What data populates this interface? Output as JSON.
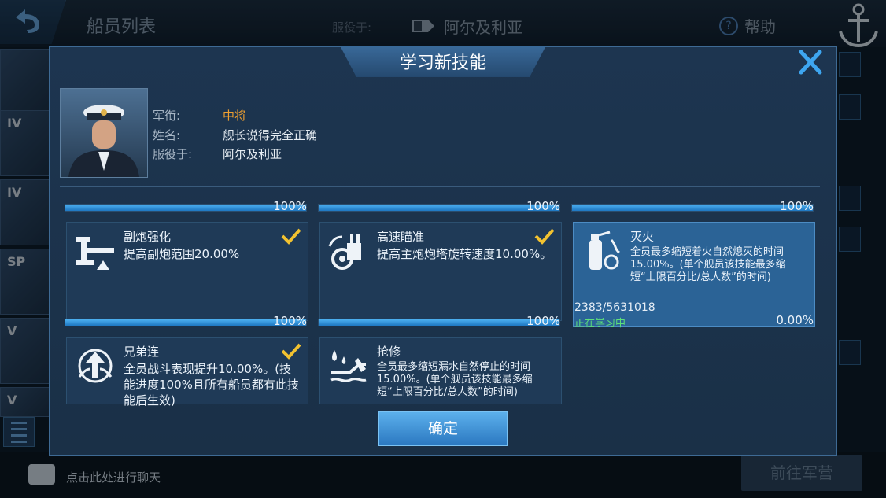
{
  "topbar": {
    "tab_title": "船员列表",
    "serving_label": "服役于:",
    "serving_ship": "阿尔及利亚",
    "help_label": "帮助"
  },
  "ship_list": [
    "",
    "IV",
    "IV",
    "SP",
    "V",
    "V"
  ],
  "bottom": {
    "chat_text": "点击此处进行聊天",
    "barracks_button": "前往军营"
  },
  "modal": {
    "title": "学习新技能",
    "rank_label": "军衔:",
    "rank_value": "中将",
    "name_label": "姓名:",
    "name_value": "舰长说得完全正确",
    "serving_label": "服役于:",
    "serving_value": "阿尔及利亚",
    "confirm_label": "确定"
  },
  "top_progress": [
    "100%",
    "100%",
    "100%"
  ],
  "skills": [
    {
      "name": "副炮强化",
      "desc": "提高副炮范围20.00%",
      "progress": "100%",
      "checked": true,
      "icon": "secondary-gun-icon"
    },
    {
      "name": "高速瞄准",
      "desc": "提高主炮炮塔旋转速度10.00%。",
      "progress": "100%",
      "checked": true,
      "icon": "turret-icon"
    },
    {
      "name": "灭火",
      "desc": "全员最多缩短着火自然熄灭的时间15.00%。(单个舰员该技能最多缩短“上限百分比/总人数”的时间)",
      "progress_count": "2383/5631018",
      "status": "正在学习中",
      "progress": "0.00%",
      "checked": false,
      "active": true,
      "icon": "fire-extinguisher-icon"
    },
    {
      "name": "兄弟连",
      "desc": "全员战斗表现提升10.00%。(技能进度100%且所有船员都有此技能后生效)",
      "checked": true,
      "icon": "brotherhood-icon"
    },
    {
      "name": "抢修",
      "desc": "全员最多缩短漏水自然停止的时间15.00%。(单个舰员该技能最多缩短“上限百分比/总人数”的时间)",
      "checked": false,
      "icon": "repair-icon"
    }
  ],
  "colors": {
    "accent": "#2b78c0",
    "check": "#f2c230",
    "rank": "#f0a030",
    "learning": "#5de07a"
  }
}
